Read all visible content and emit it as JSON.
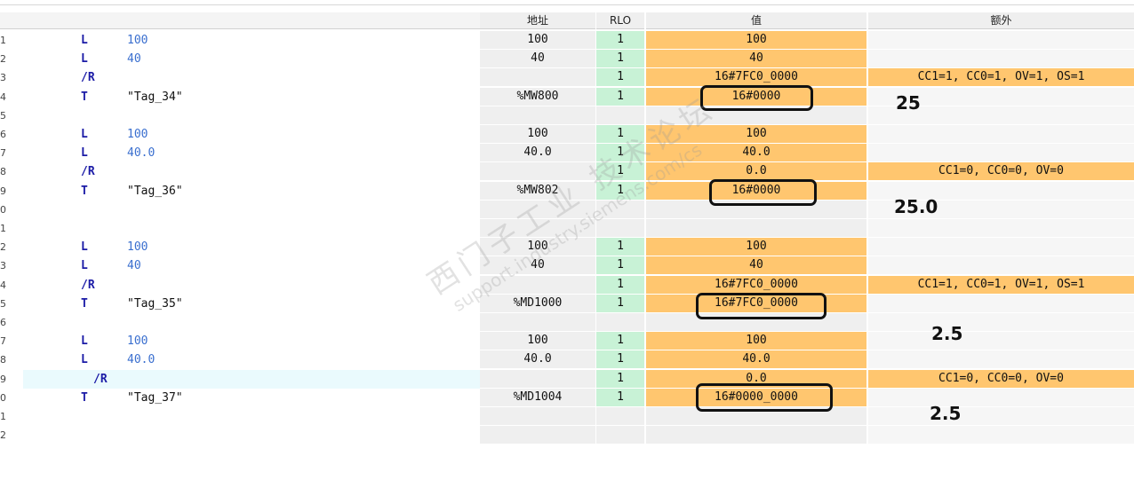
{
  "header": {
    "address": "地址",
    "rlo": "RLO",
    "value": "值",
    "extra": "额外"
  },
  "rows": [
    {
      "ln": "1",
      "op": "L",
      "arg": "100",
      "argType": "num",
      "addr": "100",
      "rlo": "1",
      "val": "100",
      "ext": ""
    },
    {
      "ln": "2",
      "op": "L",
      "arg": "40",
      "argType": "num",
      "addr": "40",
      "rlo": "1",
      "val": "40",
      "ext": ""
    },
    {
      "ln": "3",
      "op": "/R",
      "arg": "",
      "argType": "num",
      "addr": "",
      "rlo": "1",
      "val": "16#7FC0_0000",
      "ext": "CC1=1, CC0=1, OV=1, OS=1"
    },
    {
      "ln": "4",
      "op": "T",
      "arg": "\"Tag_34\"",
      "argType": "tag",
      "addr": "%MW800",
      "rlo": "1",
      "val": "16#0000",
      "ext": ""
    },
    {
      "ln": "5",
      "op": "",
      "arg": "",
      "argType": "num",
      "addr": "",
      "rlo": "",
      "val": "",
      "ext": ""
    },
    {
      "ln": "6",
      "op": "L",
      "arg": "100",
      "argType": "num",
      "addr": "100",
      "rlo": "1",
      "val": "100",
      "ext": ""
    },
    {
      "ln": "7",
      "op": "L",
      "arg": "40.0",
      "argType": "num",
      "addr": "40.0",
      "rlo": "1",
      "val": "40.0",
      "ext": ""
    },
    {
      "ln": "8",
      "op": "/R",
      "arg": "",
      "argType": "num",
      "addr": "",
      "rlo": "1",
      "val": "0.0",
      "ext": "CC1=0, CC0=0, OV=0"
    },
    {
      "ln": "9",
      "op": "T",
      "arg": "\"Tag_36\"",
      "argType": "tag",
      "addr": "%MW802",
      "rlo": "1",
      "val": "16#0000",
      "ext": ""
    },
    {
      "ln": "0",
      "op": "",
      "arg": "",
      "argType": "num",
      "addr": "",
      "rlo": "",
      "val": "",
      "ext": ""
    },
    {
      "ln": "1",
      "op": "",
      "arg": "",
      "argType": "num",
      "addr": "",
      "rlo": "",
      "val": "",
      "ext": ""
    },
    {
      "ln": "2",
      "op": "L",
      "arg": "100",
      "argType": "num",
      "addr": "100",
      "rlo": "1",
      "val": "100",
      "ext": ""
    },
    {
      "ln": "3",
      "op": "L",
      "arg": "40",
      "argType": "num",
      "addr": "40",
      "rlo": "1",
      "val": "40",
      "ext": ""
    },
    {
      "ln": "4",
      "op": "/R",
      "arg": "",
      "argType": "num",
      "addr": "",
      "rlo": "1",
      "val": "16#7FC0_0000",
      "ext": "CC1=1, CC0=1, OV=1, OS=1"
    },
    {
      "ln": "5",
      "op": "T",
      "arg": "\"Tag_35\"",
      "argType": "tag",
      "addr": "%MD1000",
      "rlo": "1",
      "val": "16#7FC0_0000",
      "ext": ""
    },
    {
      "ln": "6",
      "op": "",
      "arg": "",
      "argType": "num",
      "addr": "",
      "rlo": "",
      "val": "",
      "ext": ""
    },
    {
      "ln": "7",
      "op": "L",
      "arg": "100",
      "argType": "num",
      "addr": "100",
      "rlo": "1",
      "val": "100",
      "ext": ""
    },
    {
      "ln": "8",
      "op": "L",
      "arg": "40.0",
      "argType": "num",
      "addr": "40.0",
      "rlo": "1",
      "val": "40.0",
      "ext": ""
    },
    {
      "ln": "9",
      "op": "/R",
      "arg": "",
      "argType": "num",
      "addr": "",
      "rlo": "1",
      "val": "0.0",
      "ext": "CC1=0, CC0=0, OV=0"
    },
    {
      "ln": "0",
      "op": "T",
      "arg": "\"Tag_37\"",
      "argType": "tag",
      "addr": "%MD1004",
      "rlo": "1",
      "val": "16#0000_0000",
      "ext": ""
    },
    {
      "ln": "1",
      "op": "",
      "arg": "",
      "argType": "num",
      "addr": "",
      "rlo": "",
      "val": "",
      "ext": ""
    },
    {
      "ln": "2",
      "op": "",
      "arg": "",
      "argType": "num",
      "addr": "",
      "rlo": "",
      "val": "",
      "ext": ""
    }
  ],
  "highlighted_row": 18,
  "annotations": {
    "note1": "25",
    "note2": "25.0",
    "note3": "2.5",
    "note4": "2.5"
  },
  "watermark": {
    "line1": "西门子工业 技术论坛",
    "line2": "support.industry.siemens.com/cs"
  },
  "colors": {
    "value_fill": "#ffc66f",
    "rlo_fill": "#c8f2d6",
    "highlight": "#eafafd",
    "operator": "#1a1aa6",
    "number": "#3a6fcf"
  }
}
